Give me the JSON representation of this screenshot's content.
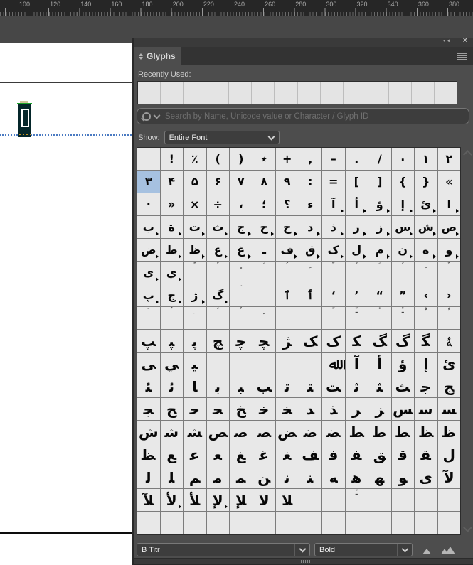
{
  "ruler": {
    "labels": [
      "100",
      "120",
      "140",
      "160",
      "180",
      "200",
      "220",
      "240",
      "260",
      "280",
      "300",
      "320",
      "340",
      "360",
      "380"
    ]
  },
  "document": {
    "guide_color": "#f24fe2",
    "baseline_color": "#4a7ac2",
    "frame_fill": "#05262a",
    "frame_selection_green": "#1ea32b"
  },
  "panel": {
    "title": "Glyphs",
    "collapse_icon": "◄◄",
    "close_icon": "×",
    "recently_used_label": "Recently Used:",
    "recent_cell_count": 14,
    "search_placeholder": "Search by Name, Unicode value or Character / Glyph ID",
    "show_label": "Show:",
    "show_value": "Entire Font",
    "font_name": "B Titr",
    "font_style": "Bold",
    "highlight_color": "#a6c1e0",
    "grid": {
      "columns": 14,
      "rows": [
        [
          "",
          "!",
          "٪",
          "(",
          ")",
          "٭",
          "+",
          ",",
          "–",
          ".",
          "/",
          "۰",
          "۱",
          "۲"
        ],
        [
          {
            "g": "۳",
            "h": 1
          },
          "۴",
          "۵",
          "۶",
          "۷",
          "۸",
          "۹",
          ":",
          "=",
          "[",
          "]",
          "{",
          "}",
          "«"
        ],
        [
          "·",
          "»",
          "×",
          "÷",
          "،",
          "؛",
          "؟",
          "ء",
          {
            "g": "آ",
            "a": 1
          },
          {
            "g": "أ",
            "a": 1
          },
          {
            "g": "ؤ",
            "a": 1
          },
          {
            "g": "إ",
            "a": 1
          },
          {
            "g": "ئ",
            "a": 1
          },
          {
            "g": "ا",
            "a": 1
          }
        ],
        [
          {
            "g": "ب",
            "a": 1
          },
          {
            "g": "ة",
            "a": 1
          },
          {
            "g": "ت",
            "a": 1
          },
          {
            "g": "ث",
            "a": 1
          },
          {
            "g": "ج",
            "a": 1
          },
          {
            "g": "ح",
            "a": 1
          },
          {
            "g": "خ",
            "a": 1
          },
          {
            "g": "د",
            "a": 1
          },
          {
            "g": "ذ",
            "a": 1
          },
          {
            "g": "ر",
            "a": 1
          },
          {
            "g": "ز",
            "a": 1
          },
          {
            "g": "س",
            "a": 1
          },
          {
            "g": "ش",
            "a": 1
          },
          {
            "g": "ص",
            "a": 1
          }
        ],
        [
          {
            "g": "ض",
            "a": 1
          },
          {
            "g": "ط",
            "a": 1
          },
          {
            "g": "ظ",
            "a": 1
          },
          {
            "g": "ع",
            "a": 1
          },
          {
            "g": "غ",
            "a": 1
          },
          "ـ",
          {
            "g": "ف",
            "a": 1
          },
          {
            "g": "ق",
            "a": 1
          },
          {
            "g": "ک",
            "a": 1
          },
          {
            "g": "ل",
            "a": 1
          },
          {
            "g": "م",
            "a": 1
          },
          {
            "g": "ن",
            "a": 1
          },
          {
            "g": "ه",
            "a": 1
          },
          {
            "g": "و",
            "a": 1
          }
        ],
        [
          {
            "g": "ى",
            "a": 1
          },
          {
            "g": "ي",
            "a": 1
          },
          {
            "g": "ﹰ",
            "s": 1
          },
          {
            "g": "ﹲ",
            "s": 1
          },
          {
            "g": "ﹴ",
            "s": 1
          },
          {
            "g": "ﹶ",
            "s": 1
          },
          {
            "g": "ﹸ",
            "s": 1
          },
          {
            "g": "ﹺ",
            "s": 1
          },
          {
            "g": "ﹼ",
            "s": 1
          },
          {
            "g": "ﹾ",
            "s": 1
          },
          {
            "g": "ﹶ",
            "s": 1
          },
          {
            "g": "ﹸ",
            "s": 1
          },
          {
            "g": "ﹺ",
            "s": 1
          },
          {
            "g": "ﹼ",
            "s": 1
          }
        ],
        [
          {
            "g": "پ",
            "a": 1
          },
          {
            "g": "چ",
            "a": 1
          },
          {
            "g": "ژ",
            "a": 1
          },
          {
            "g": "گ",
            "a": 1
          },
          {
            "g": "ﹶ",
            "s": 1
          },
          "",
          "ٱ",
          "ٲ",
          "‘",
          "’",
          "“",
          "”",
          "‹",
          "›"
        ],
        [
          {
            "g": "ﹶ",
            "s": 1
          },
          {
            "g": "ﹸ",
            "s": 1
          },
          {
            "g": "ﹺ",
            "s": 1
          },
          {
            "g": "ﹰ",
            "s": 1
          },
          {
            "g": "ﹲ",
            "s": 1
          },
          {
            "g": "ﹴ",
            "s": 1
          },
          "",
          "",
          {
            "g": "ﹼ",
            "s": 1
          },
          {
            "g": "ﹽ",
            "s": 1
          },
          {
            "g": "ﹾ",
            "s": 1
          },
          {
            "g": "ﹿ",
            "s": 1
          },
          {
            "g": "ﱞ",
            "s": 1
          },
          {
            "g": "ﱟ",
            "s": 1
          }
        ],
        [
          "ﭗ",
          "ﭙ",
          "ﭘ",
          "ﭻ",
          "ﭼ",
          "ﭽ",
          "ﮋ",
          "ﮏ",
          "ﮎ",
          "ﮑ",
          "ﮓ",
          "ﮒ",
          "ﮕ",
          "ﮥ"
        ],
        [
          "ﻰ",
          "ﻲ",
          "ﻴ",
          "",
          "",
          "",
          "",
          "",
          "ﷲ",
          "ﺁ",
          "ﺃ",
          "ﺅ",
          "ﺇ",
          "ﺉ"
        ],
        [
          "ﺌ",
          "ﺋ",
          "ﺎ",
          "ﺑ",
          "ﺒ",
          "ﺐ",
          "ﺗ",
          "ﺘ",
          "ﺖ",
          "ﺛ",
          "ﺜ",
          "ﺚ",
          "ﺟ",
          "ﺞ"
        ],
        [
          "ﺠ",
          "ﺢ",
          "ﺣ",
          "ﺤ",
          "ﺦ",
          "ﺧ",
          "ﺨ",
          "ﺪ",
          "ﺬ",
          "ﺮ",
          "ﺰ",
          "ﺲ",
          "ﺳ",
          "ﺴ"
        ],
        [
          "ﺵ",
          "ﺷ",
          "ﺸ",
          "ﺺ",
          "ﺻ",
          "ﺼ",
          "ﺾ",
          "ﺿ",
          "ﻀ",
          "ﻂ",
          "ﻃ",
          "ﻄ",
          "ﻆ",
          "ﻇ"
        ],
        [
          "ﻈ",
          "ﻊ",
          "ﻋ",
          "ﻌ",
          "ﻎ",
          "ﻏ",
          "ﻐ",
          "ﻒ",
          "ﻓ",
          "ﻔ",
          "ﻖ",
          "ﻗ",
          "ﻘ",
          "ﻝ"
        ],
        [
          "ﻟ",
          "ﻠ",
          "ﻢ",
          "ﻣ",
          "ﻤ",
          "ﻦ",
          "ﻧ",
          "ﻨ",
          "ﻪ",
          "ﻫ",
          "ﻬ",
          "ﻮ",
          "ﻯ",
          "ﻵ"
        ],
        [
          "ﻶ",
          {
            "g": "ﻷ",
            "a": 1
          },
          "ﻸ",
          {
            "g": "ﻹ",
            "a": 1
          },
          "ﻺ",
          "ﻻ",
          "ﻼ",
          "",
          "",
          {
            "g": "ﹱ",
            "s": 1
          },
          "",
          "",
          "",
          ""
        ],
        [
          "",
          "",
          "",
          "",
          "",
          "",
          "",
          "",
          "",
          "",
          "",
          "",
          "",
          ""
        ]
      ]
    }
  }
}
